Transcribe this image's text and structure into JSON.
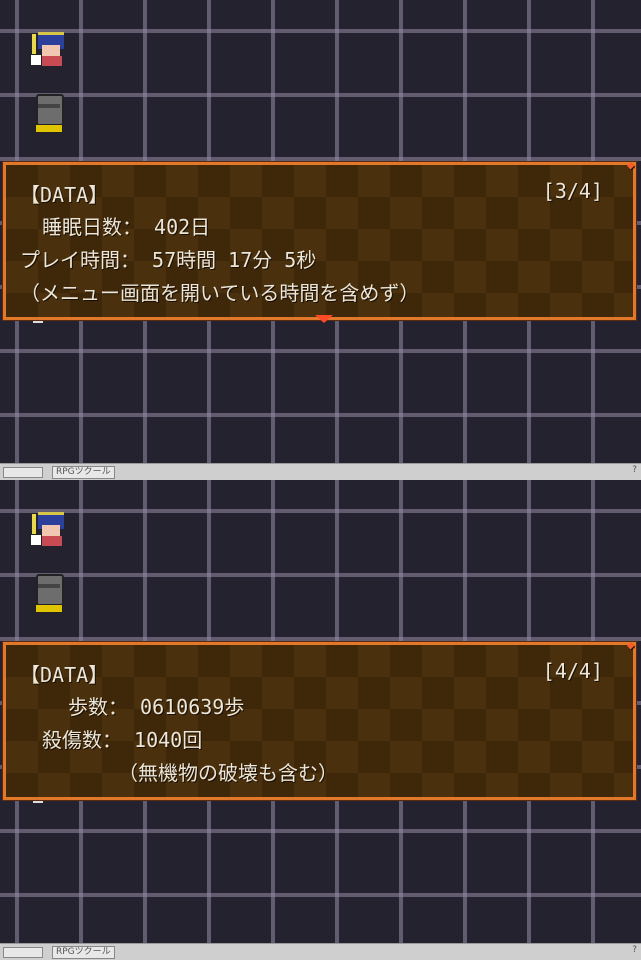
{
  "screens": [
    {
      "dialog": {
        "title": "【DATA】",
        "page": "[3/4]",
        "lines": [
          "睡眠日数： 402日",
          "プレイ時間： 57時間 17分 5秒",
          "（メニュー画面を開いている時間を含めず）"
        ]
      },
      "status": {
        "app_label": "RPGツクール",
        "help": "?"
      }
    },
    {
      "dialog": {
        "title": "【DATA】",
        "page": "[4/4]",
        "lines": [
          "歩数： 0610639歩",
          "殺傷数： 1040回",
          "（無機物の破壊も含む）"
        ]
      },
      "status": {
        "app_label": "RPGツクール",
        "help": "?"
      }
    }
  ],
  "colors": {
    "dialog_border": "#e2782a",
    "dialog_bg": "#3f2809",
    "map_bg": "#25222f"
  },
  "icons": [
    "hero-sprite",
    "barrel-sprite",
    "next-page-caret"
  ]
}
